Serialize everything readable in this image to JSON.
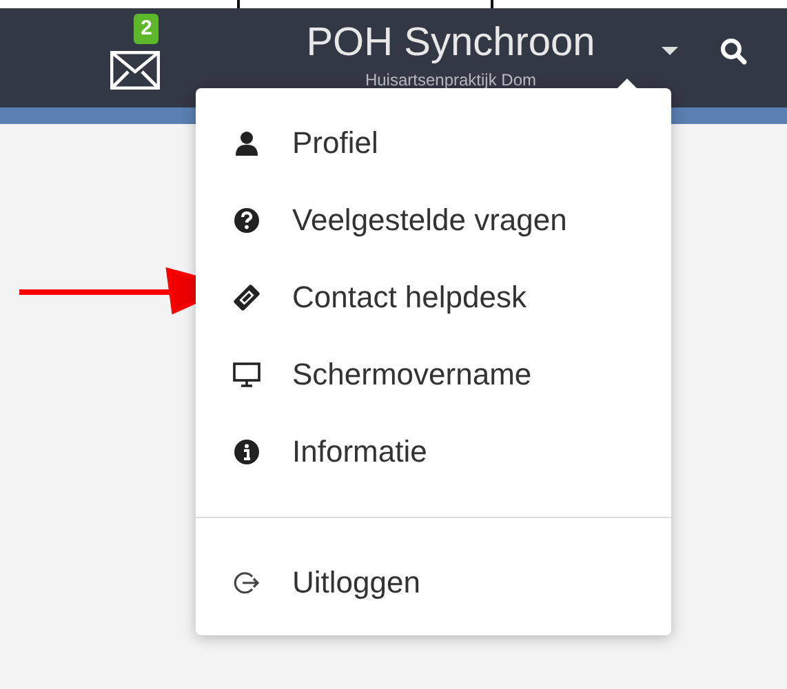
{
  "navbar": {
    "mail_badge": "2",
    "title": "POH Synchroon",
    "subtitle": "Huisartsenpraktijk Dom"
  },
  "menu": {
    "items": [
      {
        "kind": "user",
        "label": "Profiel"
      },
      {
        "kind": "question",
        "label": "Veelgestelde vragen"
      },
      {
        "kind": "ticket",
        "label": "Contact helpdesk"
      },
      {
        "kind": "desktop",
        "label": "Schermovername"
      },
      {
        "kind": "info",
        "label": "Informatie"
      },
      {
        "kind": "divider"
      },
      {
        "kind": "logout",
        "label": "Uitloggen"
      }
    ]
  }
}
